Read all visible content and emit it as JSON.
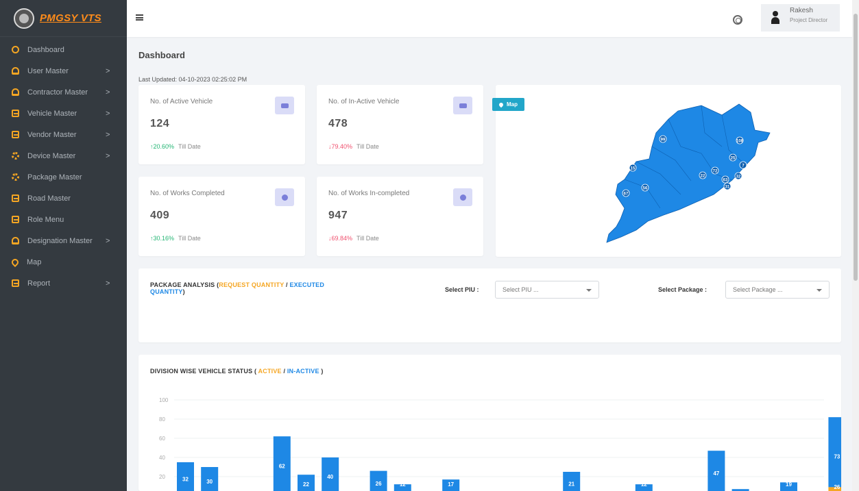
{
  "brand": {
    "name": "PMGSY VTS"
  },
  "sidebar": {
    "items": [
      {
        "label": "Dashboard",
        "icon": "dashboard-icon",
        "chevron": ""
      },
      {
        "label": "User Master",
        "icon": "user-icon",
        "chevron": ">"
      },
      {
        "label": "Contractor Master",
        "icon": "users-icon",
        "chevron": ">"
      },
      {
        "label": "Vehicle Master",
        "icon": "vehicle-icon",
        "chevron": ">"
      },
      {
        "label": "Vendor Master",
        "icon": "vendor-icon",
        "chevron": ">"
      },
      {
        "label": "Device Master",
        "icon": "device-icon",
        "chevron": ">"
      },
      {
        "label": "Package Master",
        "icon": "package-icon",
        "chevron": ""
      },
      {
        "label": "Road Master",
        "icon": "road-icon",
        "chevron": ""
      },
      {
        "label": "Role Menu",
        "icon": "role-icon",
        "chevron": ""
      },
      {
        "label": "Designation Master",
        "icon": "designation-icon",
        "chevron": ">"
      },
      {
        "label": "Map",
        "icon": "map-pin-icon",
        "chevron": ""
      },
      {
        "label": "Report",
        "icon": "report-icon",
        "chevron": ">"
      }
    ]
  },
  "header": {
    "user_name": "Rakesh",
    "user_role": "Project Director"
  },
  "page": {
    "title": "Dashboard",
    "last_updated": "Last Updated: 04-10-2023 02:25:02 PM"
  },
  "stats": {
    "active_vehicle": {
      "label": "No. of Active Vehicle",
      "value": "124",
      "trend": "↑20.60%",
      "suffix": "Till Date"
    },
    "inactive_vehicle": {
      "label": "No. of In-Active Vehicle",
      "value": "478",
      "trend": "↓79.40%",
      "suffix": "Till Date"
    },
    "works_completed": {
      "label": "No. of Works Completed",
      "value": "409",
      "trend": "↑30.16%",
      "suffix": "Till Date"
    },
    "works_incompleted": {
      "label": "No. of Works In-completed",
      "value": "947",
      "trend": "↓69.84%",
      "suffix": "Till Date"
    }
  },
  "map": {
    "badge": "Map",
    "fill_color": "#1e88e5",
    "labels": [
      {
        "text": "99"
      },
      {
        "text": "108"
      },
      {
        "text": "25"
      },
      {
        "text": "7"
      },
      {
        "text": "15"
      },
      {
        "text": "72"
      },
      {
        "text": "22"
      },
      {
        "text": "63"
      },
      {
        "text": "32"
      },
      {
        "text": "31"
      },
      {
        "text": "56"
      },
      {
        "text": "67"
      }
    ]
  },
  "package_analysis": {
    "title_prefix": "PACKAGE ANALYSIS (",
    "request": "REQUEST QUANTITY",
    "slash": " / ",
    "executed": "EXECUTED QUANTITY",
    "close": ")",
    "piu_label": "Select PIU :",
    "piu_placeholder": "Select PIU ...",
    "package_label": "Select Package :",
    "package_placeholder": "Select Package ..."
  },
  "division_status": {
    "title_prefix": "DIVISION WISE VEHICLE STATUS ( ",
    "active": "ACTIVE",
    "slash": " / ",
    "inactive": "IN-ACTIVE",
    "close": " )"
  },
  "colors": {
    "accent_orange": "#f5a623",
    "accent_blue": "#1e88e5",
    "sidebar_bg": "#343a40",
    "trend_up": "#22b573",
    "trend_down": "#f0506e"
  },
  "chart_data": {
    "type": "bar",
    "stacked": true,
    "ylim": [
      0,
      100
    ],
    "yticks": [
      20,
      40,
      60,
      80,
      100
    ],
    "categories": [
      "",
      "",
      "",
      "",
      "",
      "",
      "",
      "",
      "",
      "",
      "",
      "",
      "",
      "",
      "",
      "",
      "",
      "",
      "",
      "",
      "",
      "",
      "",
      "",
      "",
      "",
      "",
      ""
    ],
    "series": [
      {
        "name": "ACTIVE",
        "color": "#f5a623",
        "values": [
          3,
          0,
          0,
          0,
          0,
          0,
          0,
          0,
          0,
          0,
          0,
          0,
          0,
          0,
          0,
          0,
          4,
          0,
          0,
          0,
          0,
          0,
          0,
          0,
          0,
          0,
          0,
          9
        ]
      },
      {
        "name": "IN-ACTIVE",
        "color": "#1e88e5",
        "values": [
          32,
          30,
          0,
          0,
          62,
          22,
          40,
          2,
          26,
          12,
          0,
          17,
          0,
          0,
          0,
          0,
          21,
          0,
          0,
          12,
          0,
          1,
          47,
          7,
          0,
          14,
          0,
          73
        ]
      }
    ],
    "data_labels": [
      "32",
      "30",
      "",
      "",
      "62",
      "22",
      "40",
      "",
      "26",
      "12",
      "",
      "17",
      "",
      "",
      "",
      "",
      "21",
      "",
      "",
      "12",
      "",
      "",
      "47",
      "",
      "",
      "19",
      "",
      "73"
    ],
    "bottom_labels": [
      "",
      "",
      "",
      "",
      "",
      "",
      "",
      "",
      "",
      "",
      "",
      "",
      "",
      "",
      "",
      "",
      "",
      "",
      "",
      "",
      "",
      "",
      "",
      "",
      "",
      "",
      "",
      "26"
    ],
    "grid": true,
    "legend": "none"
  }
}
